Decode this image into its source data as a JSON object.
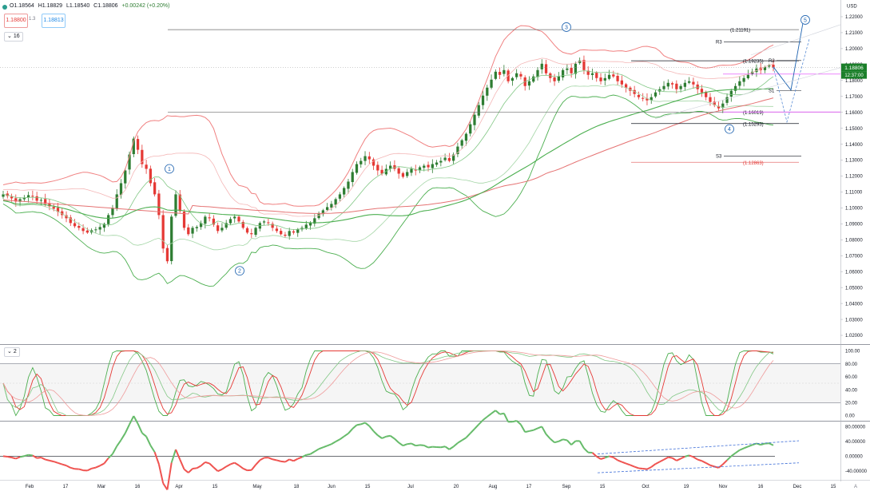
{
  "header": {
    "open": "O1.18564",
    "high": "H1.18829",
    "low": "L1.18540",
    "close": "C1.18806",
    "change": "+0.00242 (+0.20%)",
    "sell_price": "1.18800",
    "spread": "1.3",
    "buy_price": "1.18813",
    "main_indicator_count": "16",
    "stoch_indicator_count": "2",
    "currency": "USD"
  },
  "colors": {
    "up": "#2e7d32",
    "down": "#e53935",
    "band_outer": "#f08080",
    "band_inner": "#f4b6b6",
    "ma_long": "#4caf50",
    "ma_red": "#e57373",
    "price_tag": "#1b7f2a",
    "wave_label": "#1e63b0"
  },
  "chart_data": [
    {
      "type": "candlestick",
      "pair_currency": "USD",
      "ylim": [
        1.015,
        1.2285
      ],
      "yticks": [
        "1.22000",
        "1.21000",
        "1.20000",
        "1.19000",
        "1.18000",
        "1.17000",
        "1.16000",
        "1.15000",
        "1.14000",
        "1.13000",
        "1.12000",
        "1.11000",
        "1.10000",
        "1.09000",
        "1.08000",
        "1.07000",
        "1.06000",
        "1.05000",
        "1.04000",
        "1.03000",
        "1.02000"
      ],
      "x_labels": [
        "Feb",
        "17",
        "Mar",
        "16",
        "Apr",
        "15",
        "May",
        "18",
        "Jun",
        "15",
        "Jul",
        "20",
        "Aug",
        "17",
        "Sep",
        "15",
        "Oct",
        "19",
        "Nov",
        "16",
        "Dec",
        "15"
      ],
      "last_price": "1.18806",
      "countdown": "12:37:00",
      "price_marks": [
        {
          "label": "(1.21191)",
          "value": 1.21191
        },
        {
          "label": "(1.19235)",
          "value": 1.19235
        },
        {
          "label": "(1.16019)",
          "value": 1.16019
        },
        {
          "label": "(1.15293)",
          "value": 1.15293
        },
        {
          "label": "(1.12863)",
          "value": 1.12863
        }
      ],
      "pivot_labels": [
        {
          "label": "R3",
          "value": 1.2041
        },
        {
          "label": "R2",
          "value": 1.1925
        },
        {
          "label": "S1",
          "value": 1.1735
        },
        {
          "label": "S3",
          "value": 1.1325
        }
      ],
      "wave_labels": [
        "1",
        "2",
        "3",
        "4",
        "5"
      ],
      "candles_close": [
        1.1085,
        1.1075,
        1.106,
        1.104,
        1.1055,
        1.1065,
        1.108,
        1.1075,
        1.1045,
        1.105,
        1.1025,
        1.101,
        1.0995,
        1.0975,
        1.0955,
        1.0935,
        1.0905,
        1.0885,
        1.0875,
        1.0855,
        1.0845,
        1.086,
        1.0865,
        1.088,
        1.09,
        1.0955,
        1.1,
        1.1085,
        1.1155,
        1.1235,
        1.1335,
        1.1435,
        1.1365,
        1.1275,
        1.1245,
        1.1155,
        1.1085,
        1.0955,
        1.0745,
        1.0665,
        1.0945,
        1.1085,
        1.098,
        1.0875,
        1.0835,
        1.0875,
        1.088,
        1.0905,
        1.0945,
        1.0935,
        1.0895,
        1.0855,
        1.0875,
        1.0905,
        1.093,
        1.0945,
        1.0915,
        1.0875,
        1.0845,
        1.0835,
        1.0875,
        1.0905,
        1.0915,
        1.0905,
        1.0875,
        1.0855,
        1.0835,
        1.0825,
        1.0855,
        1.0845,
        1.0865,
        1.0875,
        1.0895,
        1.0905,
        1.0935,
        1.0965,
        1.0985,
        1.1005,
        1.1025,
        1.1055,
        1.1085,
        1.1125,
        1.1165,
        1.1225,
        1.1275,
        1.1295,
        1.1325,
        1.1305,
        1.1265,
        1.1235,
        1.1215,
        1.1245,
        1.1265,
        1.1245,
        1.1215,
        1.1195,
        1.1225,
        1.1245,
        1.1235,
        1.1255,
        1.1265,
        1.1255,
        1.1275,
        1.1285,
        1.1295,
        1.1315,
        1.1295,
        1.1335,
        1.1385,
        1.1425,
        1.1465,
        1.1525,
        1.1585,
        1.1645,
        1.1705,
        1.1755,
        1.1805,
        1.1855,
        1.1835,
        1.1865,
        1.1795,
        1.1815,
        1.1845,
        1.1825,
        1.1765,
        1.1795,
        1.1825,
        1.1865,
        1.1905,
        1.1845,
        1.1815,
        1.1795,
        1.1825,
        1.1865,
        1.1875,
        1.1845,
        1.1905,
        1.1925,
        1.1865,
        1.1835,
        1.1845,
        1.1815,
        1.1795,
        1.1815,
        1.1835,
        1.1825,
        1.1795,
        1.1775,
        1.1755,
        1.1735,
        1.1715,
        1.1695,
        1.1685,
        1.1675,
        1.1695,
        1.1725,
        1.1745,
        1.1765,
        1.1785,
        1.1775,
        1.1745,
        1.1765,
        1.1785,
        1.1795,
        1.1775,
        1.1745,
        1.1725,
        1.1695,
        1.1665,
        1.1645,
        1.1625,
        1.1655,
        1.1695,
        1.1735,
        1.1765,
        1.1795,
        1.1815,
        1.1835,
        1.1855,
        1.1875,
        1.1865,
        1.1885,
        1.1895,
        1.1881
      ]
    },
    {
      "type": "line",
      "name": "stochastic",
      "ylim": [
        -8,
        108
      ],
      "yticks": [
        "100.00",
        "80.00",
        "60.00",
        "40.00",
        "20.00",
        "0.00"
      ],
      "levels": [
        80,
        20
      ]
    },
    {
      "type": "line",
      "name": "oscillator",
      "ylim": [
        -62,
        92
      ],
      "yticks": [
        "80.00000",
        "40.00000",
        "0.00000",
        "-40.00000"
      ],
      "levels": [
        0
      ]
    }
  ]
}
